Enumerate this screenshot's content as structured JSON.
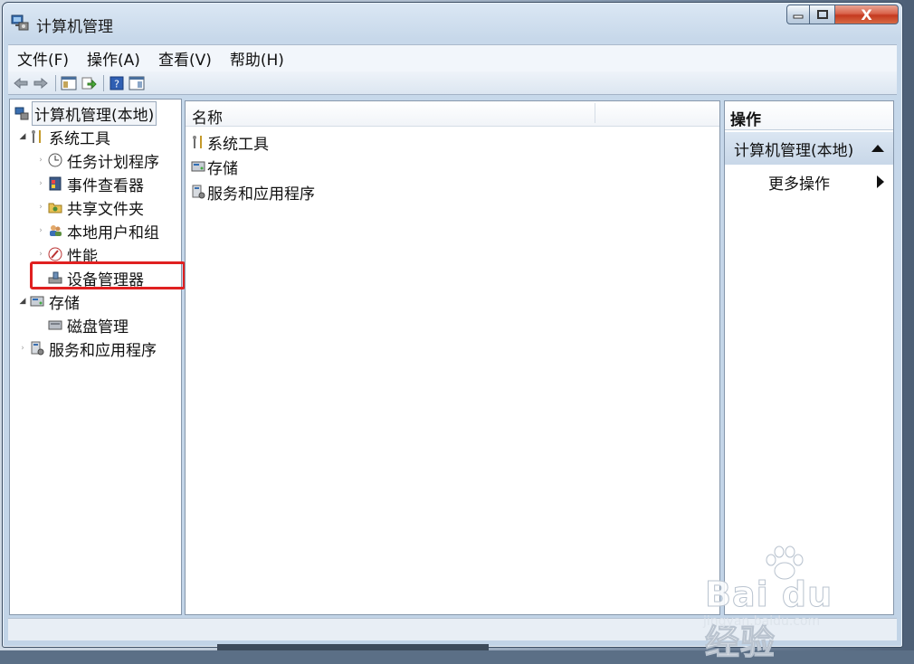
{
  "window": {
    "title": "计算机管理"
  },
  "caption": {
    "close_glyph": "X"
  },
  "menu": [
    "文件(F)",
    "操作(A)",
    "查看(V)",
    "帮助(H)"
  ],
  "toolbar": {
    "buttons": [
      "back-arrow-icon",
      "forward-arrow-icon",
      "show-hide-tree-icon",
      "export-list-icon",
      "help-icon",
      "show-action-pane-icon"
    ]
  },
  "tree": {
    "root": "计算机管理(本地)",
    "system_tools": "系统工具",
    "task_scheduler": "任务计划程序",
    "event_viewer": "事件查看器",
    "shared_folders": "共享文件夹",
    "local_users": "本地用户和组",
    "performance": "性能",
    "device_manager": "设备管理器",
    "storage": "存储",
    "disk_management": "磁盘管理",
    "services_apps": "服务和应用程序"
  },
  "list": {
    "column_name": "名称",
    "rows": [
      "系统工具",
      "存储",
      "服务和应用程序"
    ]
  },
  "actions": {
    "header": "操作",
    "group": "计算机管理(本地)",
    "more": "更多操作"
  },
  "watermark": {
    "brand": "Bai du 经验",
    "url": "jingyan.baidu.com"
  },
  "colors": {
    "highlight_box": "#e02020",
    "selection_bg": "#c8d7e8"
  }
}
